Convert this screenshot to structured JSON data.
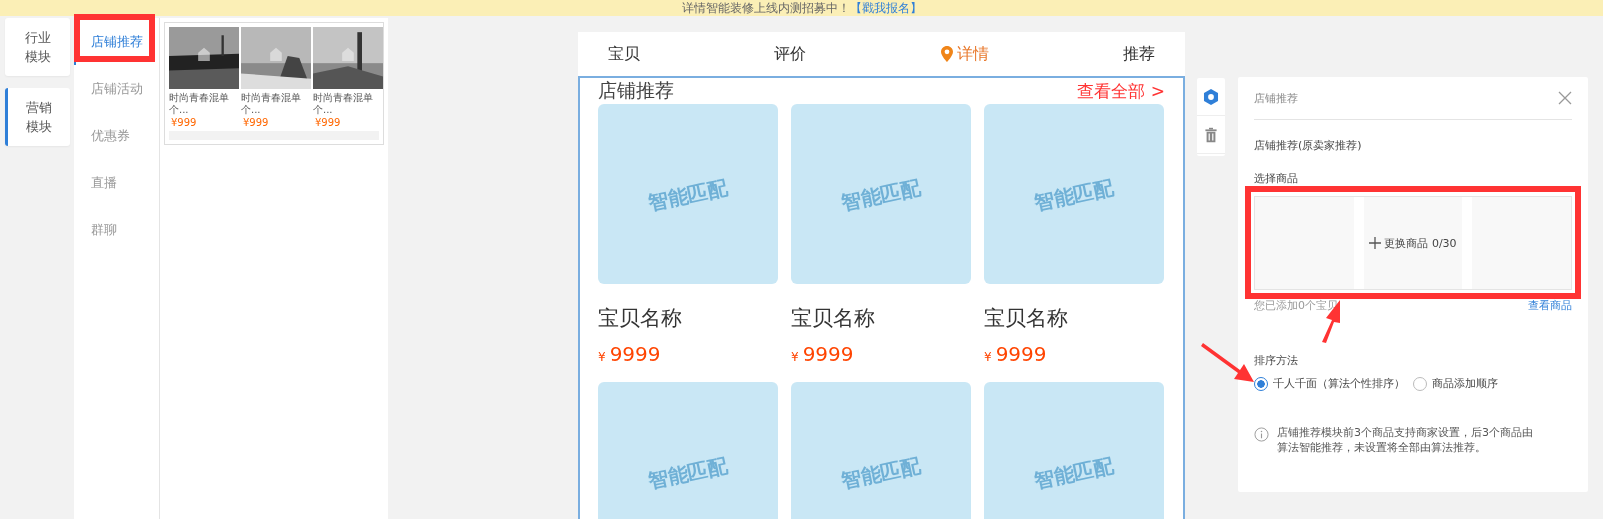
{
  "banner": {
    "text": "详情智能装修上线内测招募中！",
    "link": "【戳我报名】"
  },
  "module_groups": [
    {
      "label": "行业模块",
      "selected": false
    },
    {
      "label": "营销模块",
      "selected": true
    }
  ],
  "module_items": [
    {
      "label": "店铺推荐",
      "selected": true
    },
    {
      "label": "店铺活动",
      "selected": false
    },
    {
      "label": "优惠券",
      "selected": false
    },
    {
      "label": "直播",
      "selected": false
    },
    {
      "label": "群聊",
      "selected": false
    }
  ],
  "template_preview": {
    "items": [
      {
        "title": "时尚青春混单个...",
        "price": "¥999"
      },
      {
        "title": "时尚青春混单个...",
        "price": "¥999"
      },
      {
        "title": "时尚青春混单个...",
        "price": "¥999"
      }
    ]
  },
  "phone": {
    "tabs": [
      {
        "label": "宝贝",
        "selected": false
      },
      {
        "label": "评价",
        "selected": false
      },
      {
        "label": "详情",
        "selected": true
      },
      {
        "label": "推荐",
        "selected": false
      }
    ],
    "section_title": "店铺推荐",
    "view_all": "查看全部 >",
    "products": [
      {
        "image_label": "智能匹配",
        "name": "宝贝名称",
        "currency": "¥",
        "price": "9999"
      },
      {
        "image_label": "智能匹配",
        "name": "宝贝名称",
        "currency": "¥",
        "price": "9999"
      },
      {
        "image_label": "智能匹配",
        "name": "宝贝名称",
        "currency": "¥",
        "price": "9999"
      },
      {
        "image_label": "智能匹配"
      },
      {
        "image_label": "智能匹配"
      },
      {
        "image_label": "智能匹配"
      }
    ]
  },
  "settings_panel": {
    "title": "店铺推荐",
    "module_name": "店铺推荐(原卖家推荐)",
    "select_label": "选择商品",
    "picker_text": "更换商品 0/30",
    "added_text": "您已添加0个宝贝",
    "view_link": "查看商品",
    "sort_label": "排序方法",
    "sort_options": [
      {
        "label": "千人千面（算法个性排序）",
        "selected": true
      },
      {
        "label": "商品添加顺序",
        "selected": false
      }
    ],
    "info": "店铺推荐模块前3个商品支持商家设置，后3个商品由算法智能推荐，未设置将全部由算法推荐。"
  }
}
